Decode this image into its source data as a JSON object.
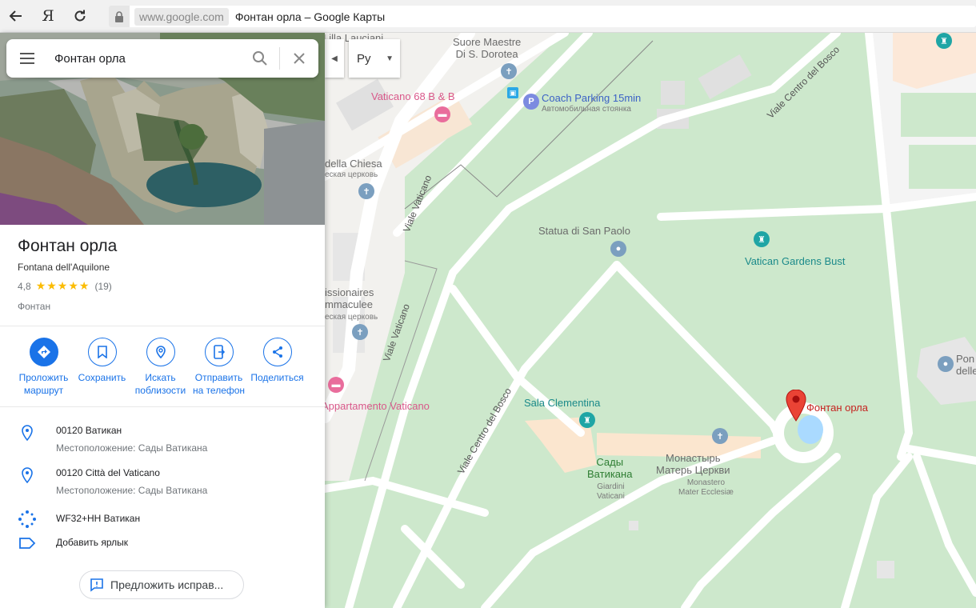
{
  "browser": {
    "back_icon": "arrow-left-icon",
    "yandex_logo": "Я",
    "reload_icon": "reload-icon",
    "domain": "www.google.com",
    "page_title": "Фонтан орла – Google Карты"
  },
  "search": {
    "value": "Фонтан орла"
  },
  "lang": {
    "value": "Ру"
  },
  "place": {
    "title": "Фонтан орла",
    "subtitle": "Fontana dell'Aquilone",
    "rating": "4,8",
    "stars": "★★★★★",
    "reviews": "(19)",
    "category": "Фонтан"
  },
  "actions": [
    {
      "label": "Проложить\nмаршрут"
    },
    {
      "label": "Сохранить"
    },
    {
      "label": "Искать\nпоблизости"
    },
    {
      "label": "Отправить\nна телефон"
    },
    {
      "label": "Поделиться"
    }
  ],
  "info": {
    "address1": {
      "main": "00120 Ватикан",
      "sub": "Местоположение: Сады Ватикана"
    },
    "address2": {
      "main": "00120 Città del Vaticano",
      "sub": "Местоположение: Сады Ватикана"
    },
    "pluscode": "WF32+HH Ватикан",
    "label": "Добавить ярлык"
  },
  "suggest_edit": "Предложить исправ...",
  "map": {
    "labels": {
      "lilla": "Lilla Lauciani",
      "suore": "Suore Maestre\nDi S. Dorotea",
      "vaticano68": "Vaticano 68 B & B",
      "coach": "Coach Parking 15min",
      "coach_sub": "Автомобильная стоянка",
      "della_chiesa": "della Chiesa",
      "della_chiesa_sub": "еская церковь",
      "statua": "Statua di San Paolo",
      "gardens_bust": "Vatican Gardens Bust",
      "missionarie": "issionaires\nmmaculee",
      "missionarie_sub": "еская церковь",
      "appartamento": "Appartamento Vaticano",
      "sala": "Sala Clementina",
      "giardini": "Сады\nВатикана",
      "giardini_sub": "Giardini\nVaticani",
      "monastero": "Монастырь\nМатерь Церкви",
      "monastero_sub": "Monastero\nMater Ecclesiæ",
      "fontana": "Фонтан орла",
      "pont": "Pon\ndelle",
      "viale_vaticano_1": "Viale Vaticano",
      "viale_vaticano_2": "Viale Vaticano",
      "viale_bosco_1": "Viale Centro del Bosco",
      "viale_bosco_2": "Viale Centro del Bosco"
    },
    "colors": {
      "park": "#c8e6c9",
      "road": "#ffffff",
      "built": "#e8e8e8",
      "water": "#aadaff",
      "pin": "#ea4335"
    }
  }
}
